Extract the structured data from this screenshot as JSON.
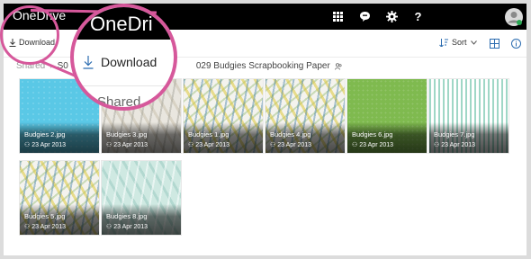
{
  "app": {
    "brand": "OneDrive"
  },
  "topbar": {
    "icons": [
      "app-launcher-icon",
      "chat-icon",
      "gear-icon",
      "help-icon",
      "avatar"
    ]
  },
  "commandbar": {
    "download_label": "Download",
    "sort_label": "Sort"
  },
  "breadcrumb": {
    "root": "Shared",
    "middle": "S0",
    "current": "029 Budgies Scrapbooking Paper"
  },
  "files": [
    {
      "name": "Budgies 2.jpg",
      "date": "23 Apr 2013"
    },
    {
      "name": "Budgies 3.jpg",
      "date": "23 Apr 2013"
    },
    {
      "name": "Budgies 1.jpg",
      "date": "23 Apr 2013"
    },
    {
      "name": "Budgies 4.jpg",
      "date": "23 Apr 2013"
    },
    {
      "name": "Budgies 6.jpg",
      "date": "23 Apr 2013"
    },
    {
      "name": "Budgies 7.jpg",
      "date": "23 Apr 2013"
    },
    {
      "name": "Budgies 5.jpg",
      "date": "23 Apr 2013"
    },
    {
      "name": "Budgies 8.jpg",
      "date": "23 Apr 2013"
    }
  ],
  "magnifier": {
    "title": "OneDri",
    "download_label": "Download",
    "shared_label": "Shared"
  },
  "colors": {
    "topbar": "#000000",
    "accent": "#2b6cb0",
    "highlight": "#d6589b"
  }
}
